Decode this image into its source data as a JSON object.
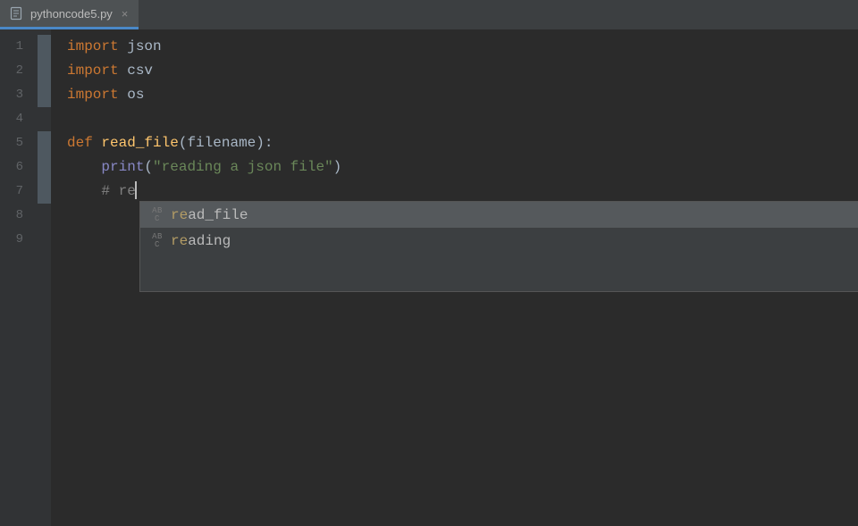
{
  "tab": {
    "filename": "pythoncode5.py",
    "close_glyph": "×"
  },
  "gutter": {
    "lines": [
      "1",
      "2",
      "3",
      "4",
      "5",
      "6",
      "7",
      "8",
      "9"
    ],
    "indicators": [
      true,
      true,
      true,
      false,
      true,
      true,
      true,
      false,
      false
    ]
  },
  "code": {
    "l1": {
      "kw": "import",
      "sp": " ",
      "mod": "json"
    },
    "l2": {
      "kw": "import",
      "sp": " ",
      "mod": "csv"
    },
    "l3": {
      "kw": "import",
      "sp": " ",
      "mod": "os"
    },
    "l5": {
      "kw": "def",
      "sp": " ",
      "fn": "read_file",
      "open": "(",
      "arg": "filename",
      "close": "):"
    },
    "l6": {
      "indent": "    ",
      "call": "print",
      "open": "(",
      "str": "\"reading a json file\"",
      "close": ")"
    },
    "l7": {
      "indent": "    ",
      "hash": "# ",
      "text": "re"
    }
  },
  "autocomplete": {
    "kind_top": "AB",
    "kind_bot": "C",
    "items": [
      {
        "match": "re",
        "rest": "ad_file",
        "selected": true
      },
      {
        "match": "re",
        "rest": "ading",
        "selected": false
      }
    ]
  }
}
